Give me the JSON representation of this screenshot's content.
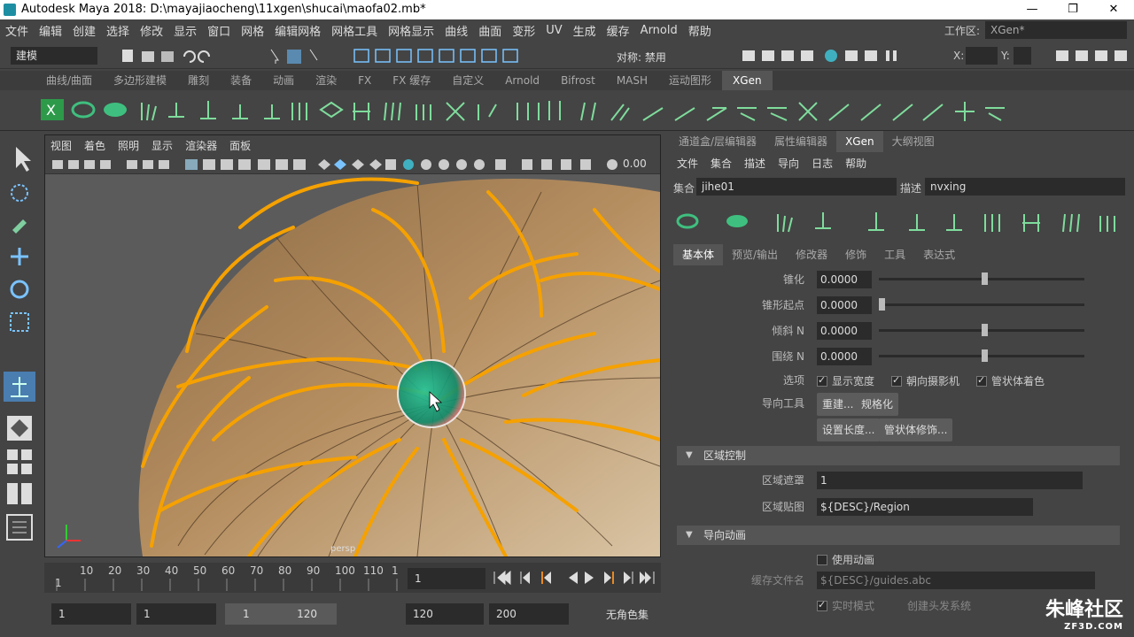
{
  "window": {
    "title": "Autodesk Maya 2018: D:\\mayajiaocheng\\11xgen\\shucai\\maofa02.mb*",
    "minimize": "—",
    "restore": "❐",
    "close": "✕"
  },
  "menu": [
    "文件",
    "编辑",
    "创建",
    "选择",
    "修改",
    "显示",
    "窗口",
    "网格",
    "编辑网格",
    "网格工具",
    "网格显示",
    "曲线",
    "曲面",
    "变形",
    "UV",
    "生成",
    "缓存",
    "Arnold",
    "帮助"
  ],
  "workspace": {
    "label": "工作区:",
    "value": "XGen*"
  },
  "statusline": {
    "mode": "建模",
    "symmetry": "对称: 禁用",
    "x_label": "X:",
    "y_label": "Y:"
  },
  "shelf_tabs": [
    "曲线/曲面",
    "多边形建模",
    "雕刻",
    "装备",
    "动画",
    "渲染",
    "FX",
    "FX 缓存",
    "自定义",
    "Arnold",
    "Bifrost",
    "MASH",
    "运动图形",
    "XGen"
  ],
  "shelf_active": "XGen",
  "viewport": {
    "menu": [
      "视图",
      "着色",
      "照明",
      "显示",
      "渲染器",
      "面板"
    ],
    "value": "0.00",
    "camera": "persp"
  },
  "timeline": {
    "ticks": [
      "1",
      "10",
      "20",
      "30",
      "40",
      "50",
      "60",
      "70",
      "80",
      "90",
      "100",
      "110",
      "1"
    ],
    "current": "1"
  },
  "range": {
    "start": "1",
    "start2": "1",
    "slider_start": "1",
    "slider_end": "120",
    "end": "120",
    "end2": "200",
    "charset": "无角色集"
  },
  "panel": {
    "tabs": [
      "通道盒/层编辑器",
      "属性编辑器",
      "XGen",
      "大纲视图"
    ],
    "active_tab": "XGen",
    "menu": [
      "文件",
      "集合",
      "描述",
      "导向",
      "日志",
      "帮助"
    ],
    "collection_label": "集合",
    "collection": "jihe01",
    "description_label": "描述",
    "description": "nvxing",
    "subtabs": [
      "基本体",
      "预览/输出",
      "修改器",
      "修饰",
      "工具",
      "表达式"
    ],
    "active_subtab": "基本体",
    "attrs": [
      {
        "label": "锥化",
        "value": "0.0000",
        "pos": 0.5
      },
      {
        "label": "锥形起点",
        "value": "0.0000",
        "pos": 0.0
      },
      {
        "label": "倾斜 N",
        "value": "0.0000",
        "pos": 0.5
      },
      {
        "label": "围绕 N",
        "value": "0.0000",
        "pos": 0.5
      }
    ],
    "options_label": "选项",
    "options": [
      {
        "label": "显示宽度",
        "checked": true
      },
      {
        "label": "朝向摄影机",
        "checked": true
      },
      {
        "label": "管状体着色",
        "checked": true
      }
    ],
    "guide_tools_label": "导向工具",
    "buttons": [
      "重建...",
      "规格化",
      "设置长度...",
      "管状体修饰..."
    ],
    "region_section": "区域控制",
    "region_mask_label": "区域遮罩",
    "region_mask": "1",
    "region_map_label": "区域贴图",
    "region_map": "${DESC}/Region",
    "anim_section": "导向动画",
    "use_anim": "使用动画",
    "cache_label": "缓存文件名",
    "cache": "${DESC}/guides.abc",
    "live_mode": "实时模式",
    "create_hair": "创建头发系统"
  },
  "watermark": {
    "main": "朱峰社区",
    "sub": "ZF3D.COM"
  },
  "colors": {
    "accent": "#e89a10",
    "xgen_green": "#3fbf7f",
    "bg": "#444444"
  }
}
